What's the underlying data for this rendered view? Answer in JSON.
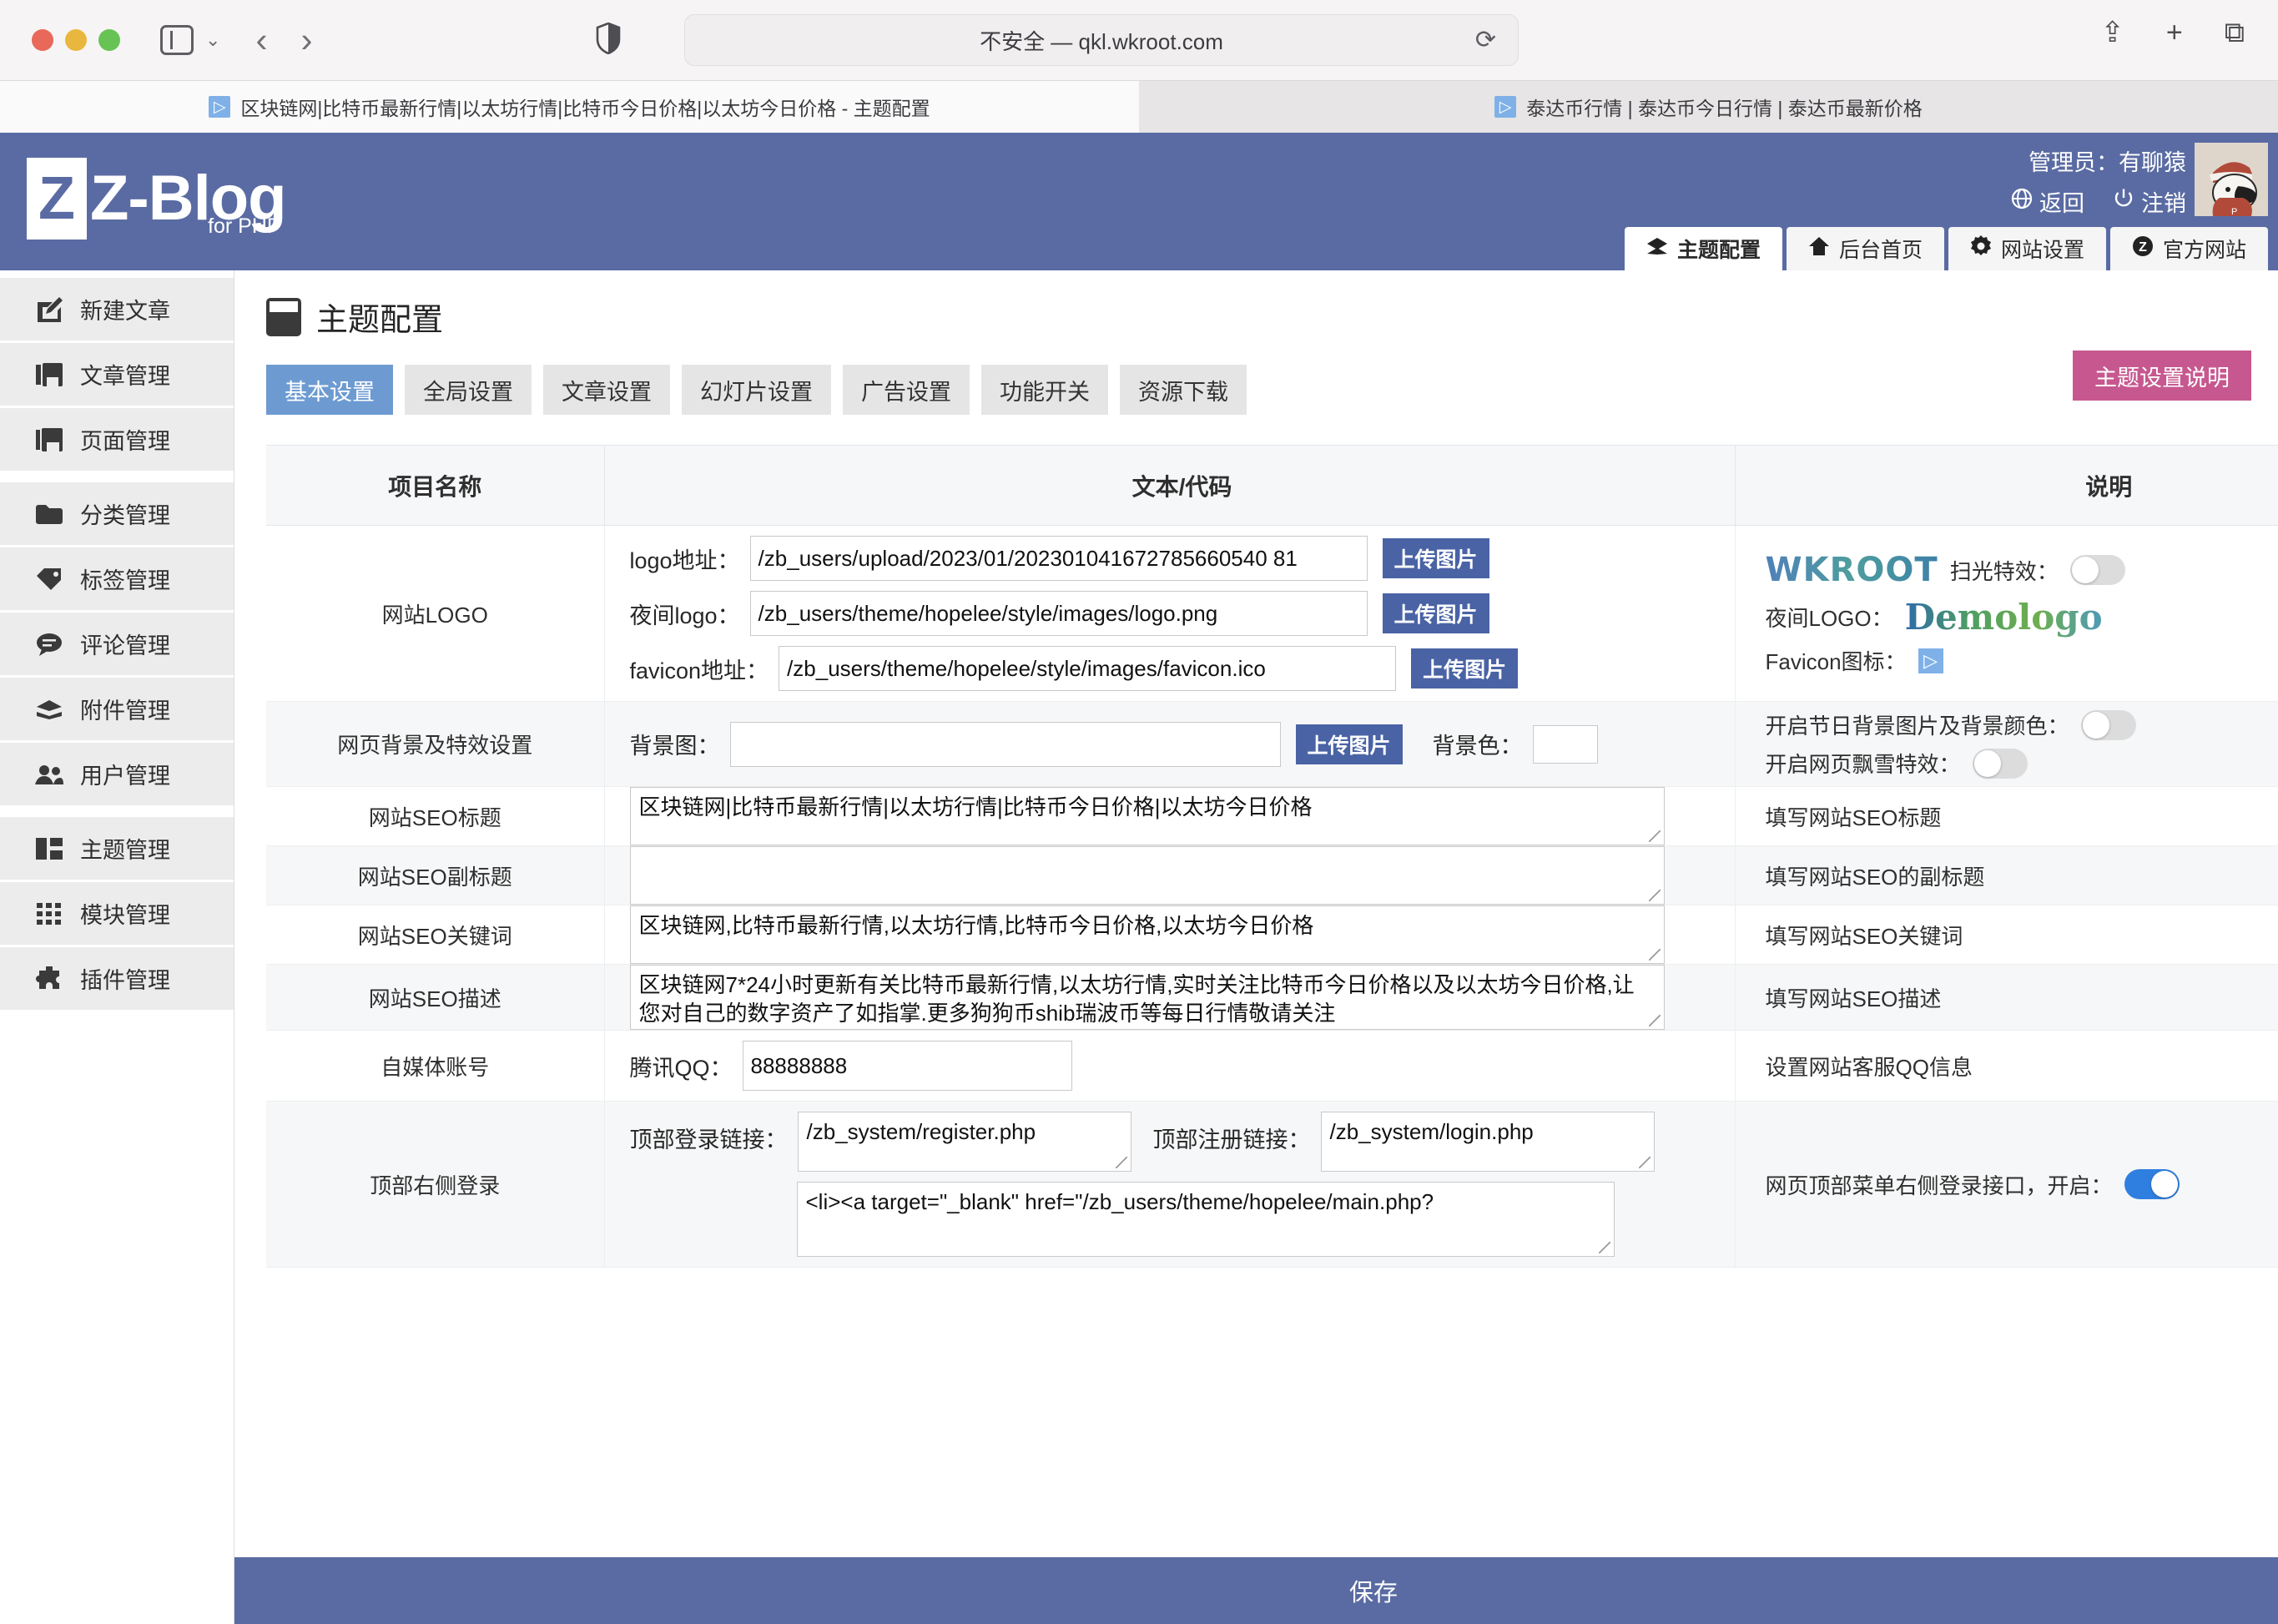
{
  "browser": {
    "url_text": "不安全 — qkl.wkroot.com",
    "tabs": [
      {
        "title": "区块链网|比特币最新行情|以太坊行情|比特币今日价格|以太坊今日价格 - 主题配置",
        "active": true
      },
      {
        "title": "泰达币行情 | 泰达币今日行情 | 泰达币最新价格",
        "active": false
      }
    ],
    "icons": {
      "sidebar": "sidebar-toggle-icon",
      "back": "‹",
      "forward": "›",
      "shield": "shield-icon",
      "reload": "⟳",
      "share": "⇪",
      "new_tab": "+",
      "tab_overview": "⧉"
    }
  },
  "header": {
    "logo_letter": "Z",
    "logo_main": "Z-Blog",
    "logo_sub": "for PHP",
    "admin_label": "管理员：有聊猿",
    "back_label": "返回",
    "logout_label": "注销",
    "nav": [
      {
        "label": "主题配置",
        "icon": "diamond-icon",
        "active": true
      },
      {
        "label": "后台首页",
        "icon": "home-icon",
        "active": false
      },
      {
        "label": "网站设置",
        "icon": "gear-icon",
        "active": false
      },
      {
        "label": "官方网站",
        "icon": "zblog-circle-icon",
        "active": false
      }
    ]
  },
  "sidebar": {
    "items": [
      {
        "label": "新建文章",
        "icon": "edit-icon"
      },
      {
        "label": "文章管理",
        "icon": "articles-icon"
      },
      {
        "label": "页面管理",
        "icon": "page-icon"
      },
      {
        "label": "分类管理",
        "icon": "folder-icon"
      },
      {
        "label": "标签管理",
        "icon": "tag-icon"
      },
      {
        "label": "评论管理",
        "icon": "comment-icon"
      },
      {
        "label": "附件管理",
        "icon": "attachment-icon"
      },
      {
        "label": "用户管理",
        "icon": "users-icon"
      },
      {
        "label": "主题管理",
        "icon": "theme-icon"
      },
      {
        "label": "模块管理",
        "icon": "modules-icon"
      },
      {
        "label": "插件管理",
        "icon": "plugin-icon"
      }
    ]
  },
  "main": {
    "page_title": "主题配置",
    "tabs": [
      {
        "label": "基本设置",
        "active": true
      },
      {
        "label": "全局设置",
        "active": false
      },
      {
        "label": "文章设置",
        "active": false
      },
      {
        "label": "幻灯片设置",
        "active": false
      },
      {
        "label": "广告设置",
        "active": false
      },
      {
        "label": "功能开关",
        "active": false
      },
      {
        "label": "资源下载",
        "active": false
      }
    ],
    "help_button": "主题设置说明",
    "table_headers": {
      "name": "项目名称",
      "value": "文本/代码",
      "desc": "说明"
    },
    "save_button": "保存"
  },
  "rows": {
    "logo": {
      "name": "网站LOGO",
      "logo_label": "logo地址：",
      "logo_value": "/zb_users/upload/2023/01/202301041672785660540 81",
      "night_label": "夜间logo：",
      "night_value": "/zb_users/theme/hopelee/style/images/logo.png",
      "favicon_label": "favicon地址：",
      "favicon_value": "/zb_users/theme/hopelee/style/images/favicon.ico",
      "upload_label": "上传图片",
      "desc_wkroot": "WKROOT",
      "desc_scan_label": "扫光特效：",
      "desc_scan_on": false,
      "desc_night_label": "夜间LOGO：",
      "desc_night_logo": "Demologo",
      "desc_favicon_label": "Favicon图标："
    },
    "background": {
      "name": "网页背景及特效设置",
      "bgimg_label": "背景图：",
      "bgimg_value": "",
      "upload_label": "上传图片",
      "bgcolor_label": "背景色：",
      "bgcolor_value": "",
      "desc_holiday_label": "开启节日背景图片及背景颜色：",
      "desc_holiday_on": false,
      "desc_snow_label": "开启网页飘雪特效：",
      "desc_snow_on": false
    },
    "seo_title": {
      "name": "网站SEO标题",
      "value": "区块链网|比特币最新行情|以太坊行情|比特币今日价格|以太坊今日价格",
      "desc": "填写网站SEO标题"
    },
    "seo_subtitle": {
      "name": "网站SEO副标题",
      "value": "",
      "desc": "填写网站SEO的副标题"
    },
    "seo_keywords": {
      "name": "网站SEO关键词",
      "value": "区块链网,比特币最新行情,以太坊行情,比特币今日价格,以太坊今日价格",
      "desc": "填写网站SEO关键词"
    },
    "seo_description": {
      "name": "网站SEO描述",
      "value": "区块链网7*24小时更新有关比特币最新行情,以太坊行情,实时关注比特币今日价格以及以太坊今日价格,让您对自己的数字资产了如指掌.更多狗狗币shib瑞波币等每日行情敬请关注",
      "desc": "填写网站SEO描述"
    },
    "media_account": {
      "name": "自媒体账号",
      "qq_label": "腾讯QQ：",
      "qq_value": "88888888",
      "desc": "设置网站客服QQ信息"
    },
    "top_login": {
      "name": "顶部右侧登录",
      "login_link_label": "顶部登录链接：",
      "login_link_value": "/zb_system/register.php",
      "register_link_label": "顶部注册链接：",
      "register_link_value": "/zb_system/login.php",
      "code_value": "<li><a target=\"_blank\" href=\"/zb_users/theme/hopelee/main.php?",
      "desc_label": "网页顶部菜单右侧登录接口，开启：",
      "desc_on": true
    }
  },
  "colors": {
    "brand": "#5a6ba3",
    "tab_active": "#6d9bd1",
    "help": "#c7588f",
    "upload": "#4a63a5",
    "toggle_on": "#2f7fe0"
  }
}
